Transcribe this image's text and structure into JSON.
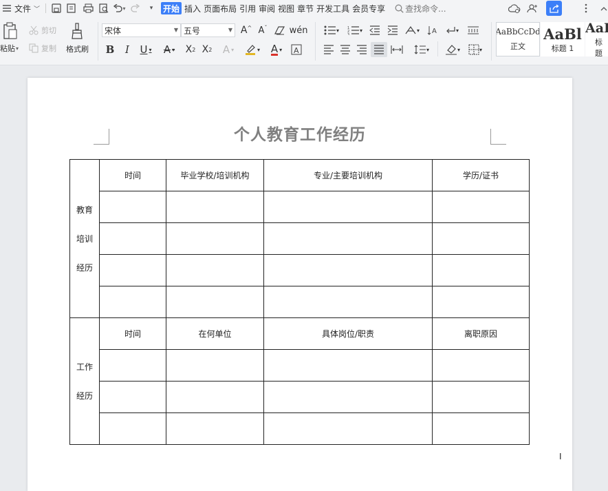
{
  "menubar": {
    "file_label": "文件",
    "tabs": [
      {
        "label": "开始",
        "active": true
      },
      {
        "label": "插入",
        "active": false
      },
      {
        "label": "页面布局",
        "active": false
      },
      {
        "label": "引用",
        "active": false
      },
      {
        "label": "审阅",
        "active": false
      },
      {
        "label": "视图",
        "active": false
      },
      {
        "label": "章节",
        "active": false
      },
      {
        "label": "开发工具",
        "active": false
      },
      {
        "label": "会员专享",
        "active": false
      }
    ],
    "search_placeholder": "查找命令..."
  },
  "ribbon": {
    "paste_label": "粘贴",
    "cut_label": "剪切",
    "copy_label": "复制",
    "format_painter_label": "格式刷",
    "font_name": "宋体",
    "font_size": "五号",
    "styles": [
      {
        "preview": "AaBbCcDd",
        "label": "正文"
      },
      {
        "preview": "AaBl",
        "label": "标题 1"
      },
      {
        "preview": "AaBl",
        "label": "标题"
      }
    ]
  },
  "document": {
    "title": "个人教育工作经历",
    "education": {
      "side_lines": [
        "教育",
        "培训",
        "经历"
      ],
      "headers": [
        "时间",
        "毕业学校/培训机构",
        "专业/主要培训机构",
        "学历/证书"
      ],
      "empty_rows": 4
    },
    "work": {
      "side_lines": [
        "工作",
        "经历"
      ],
      "headers": [
        "时间",
        "在何单位",
        "具体岗位/职责",
        "离职原因"
      ],
      "empty_rows": 3
    }
  },
  "colors": {
    "accent": "#3c7ff8",
    "title_gray": "#808080",
    "font_color_red": "#d9322b",
    "font_color_blue": "#2f55d4"
  }
}
